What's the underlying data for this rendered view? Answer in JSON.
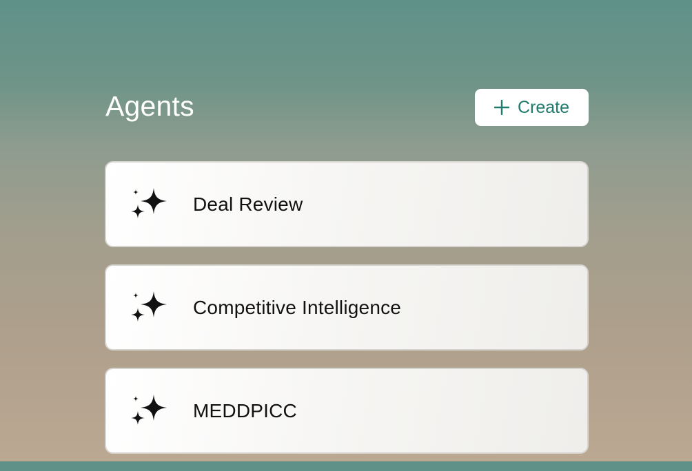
{
  "header": {
    "title": "Agents",
    "create_label": "Create"
  },
  "agents": [
    {
      "label": "Deal Review",
      "icon": "sparkles-icon"
    },
    {
      "label": "Competitive Intelligence",
      "icon": "sparkles-icon"
    },
    {
      "label": "MEDDPICC",
      "icon": "sparkles-icon"
    }
  ],
  "colors": {
    "accent": "#1e7a6a",
    "title_text": "#ffffff",
    "card_text": "#111111"
  }
}
